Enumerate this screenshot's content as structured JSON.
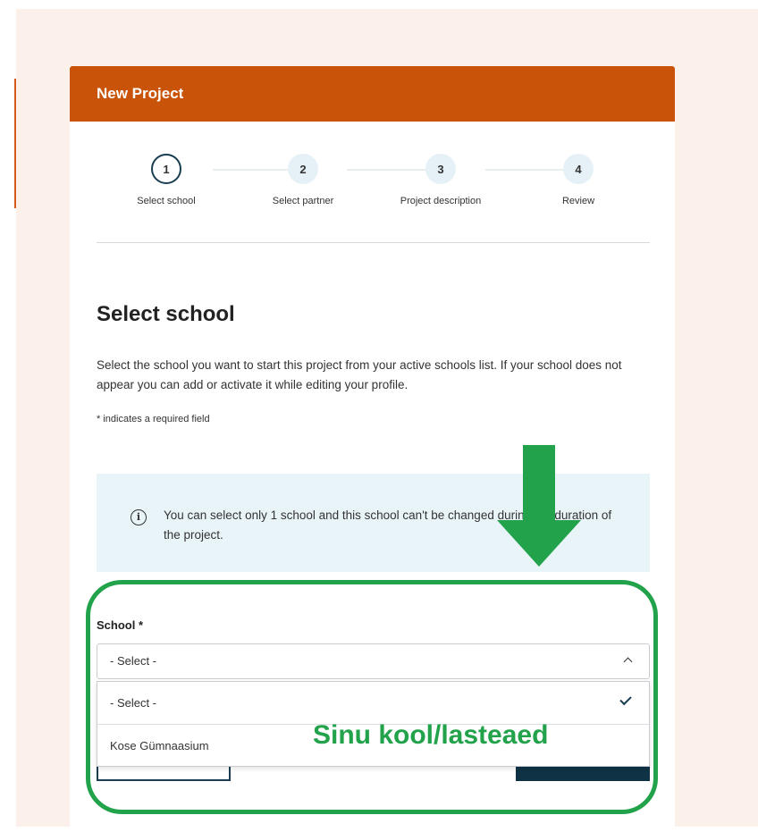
{
  "header": {
    "title": "New Project"
  },
  "stepper": {
    "steps": [
      {
        "number": "1",
        "label": "Select school"
      },
      {
        "number": "2",
        "label": "Select partner"
      },
      {
        "number": "3",
        "label": "Project description"
      },
      {
        "number": "4",
        "label": "Review"
      }
    ],
    "active_step": 1
  },
  "main": {
    "title": "Select school",
    "description": "Select the school you want to start this project from your active schools list. If your school does not appear you can add or activate it while editing your profile.",
    "required_note": "* indicates a required field",
    "info": {
      "icon": "info-icon",
      "text": "You can select only 1 school and this school can't be changed during the duration of the project."
    },
    "school_field": {
      "label": "School *",
      "selected_value": "- Select -",
      "options": [
        "- Select -",
        "Kose Gümnaasium"
      ]
    }
  },
  "annotation": {
    "text": "Sinu kool/lasteaed",
    "color": "#22a34b"
  },
  "colors": {
    "header": "#c85309",
    "info_background": "#e9f4f9",
    "primary_button": "#0f3344",
    "annotation": "#22a34b"
  }
}
